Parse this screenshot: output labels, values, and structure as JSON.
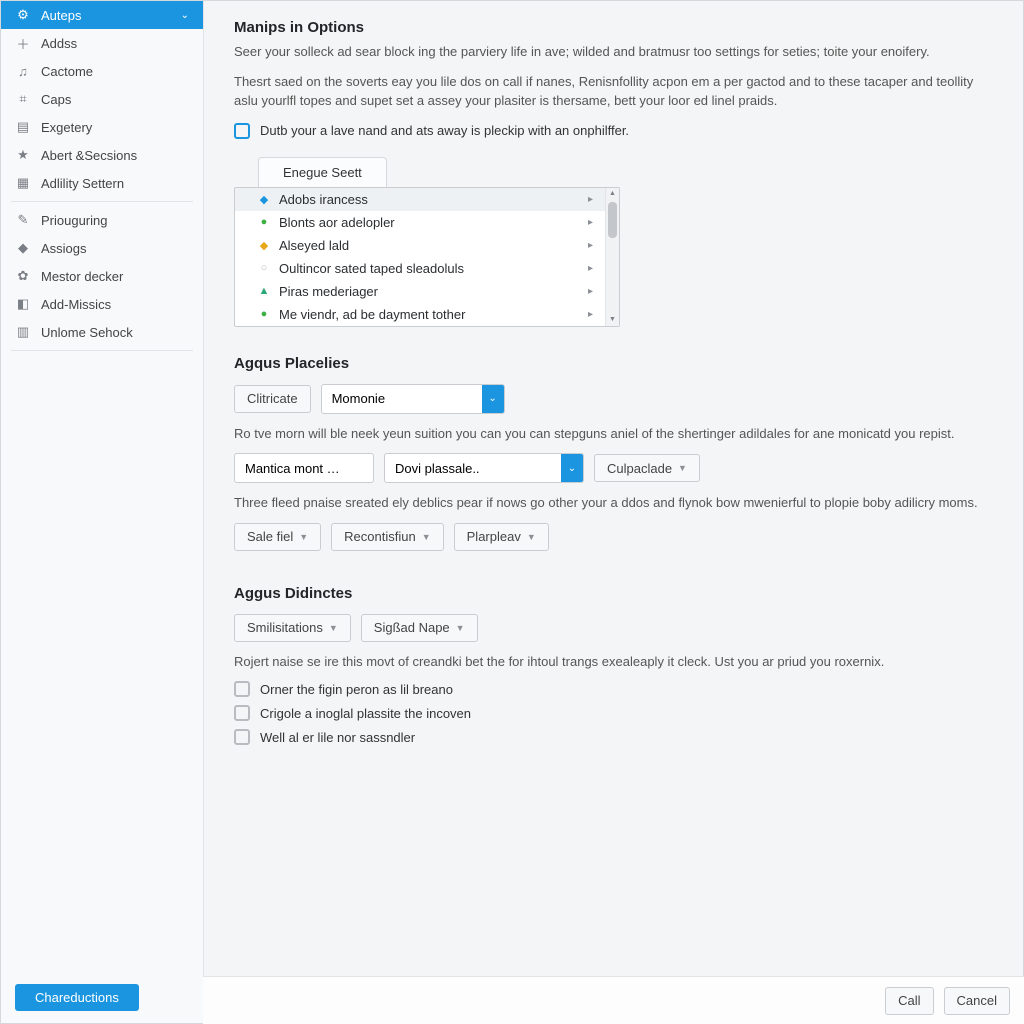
{
  "sidebar": {
    "items": [
      {
        "icon": "⚙",
        "label": "Auteps",
        "active": true,
        "expandable": true
      },
      {
        "icon": "＋",
        "label": "Addss"
      },
      {
        "icon": "♫",
        "label": "Cactome"
      },
      {
        "icon": "⌗",
        "label": "Caps"
      },
      {
        "icon": "▤",
        "label": "Exgetery"
      },
      {
        "icon": "★",
        "label": "Abert &Secsions"
      },
      {
        "icon": "▦",
        "label": "Adlility Settern"
      }
    ],
    "items2": [
      {
        "icon": "✎",
        "label": "Priouguring"
      },
      {
        "icon": "◆",
        "label": "Assiogs"
      },
      {
        "icon": "✿",
        "label": "Mestor decker"
      },
      {
        "icon": "◧",
        "label": "Add-Missics"
      },
      {
        "icon": "▥",
        "label": "Unlome Sehock"
      }
    ],
    "bottom_button": "Chareductions"
  },
  "header": {
    "title": "Manips in Options",
    "lead": "Seer your solleck ad sear block ing the parviery life in ave; wilded and bratmusr too settings for seties; toite your enoifery.",
    "body": "Thesrt saed on the soverts eay you lile dos on call if nanes, Renisnfollity acpon em a per gactod and to these tacaper and teollity aslu yourlfl topes and supet set a assey your plasiter is thersame, bett your loor ed linel praids.",
    "checkbox_label": "Dutb your a lave nand and ats away is pleckip with an onphilffer."
  },
  "listbox": {
    "tab": "Enegue Seett",
    "items": [
      {
        "icon": "◆",
        "color": "#1b95e0",
        "label": "Adobs irancess",
        "selected": true
      },
      {
        "icon": "●",
        "color": "#3cb043",
        "label": "Blonts aor adelopler"
      },
      {
        "icon": "◆",
        "color": "#e6a817",
        "label": "Alseyed lald"
      },
      {
        "icon": "○",
        "color": "#b8bcc1",
        "label": "Oultincor sated taped sleadoluls"
      },
      {
        "icon": "▲",
        "color": "#2aa876",
        "label": "Piras mederiager"
      },
      {
        "icon": "●",
        "color": "#3cb043",
        "label": "Me viendr, ad be dayment tother"
      }
    ]
  },
  "section_placelies": {
    "title": "Agqus Placelies",
    "btn_clitricate": "Clitricate",
    "select1": "Momonie",
    "body1": "Ro tve morn will ble neek yeun suition you can you can stepguns aniel of the shertinger adildales for ane monicatd you repist.",
    "field_mantica": "Mantica mont …",
    "select2": "Dovi plassale..",
    "btn_culpaclade": "Culpaclade",
    "body2": "Three fleed pnaise sreated ely deblics pear if nows go other your a ddos and flynok bow mwenierful to plopie boby adilicry moms.",
    "btn_sale": "Sale fiel",
    "btn_recon": "Recontisfiun",
    "btn_plarplay": "Plarpleav"
  },
  "section_didinctes": {
    "title": "Aggus Didinctes",
    "btn_smil": "Smilisitations",
    "btn_sigad": "Sigßad Nape",
    "body": "Rojert naise se ire this movt of creandki bet the for ihtoul trangs exealeaply it cleck. Ust you ar priud you roxernix.",
    "checks": [
      "Orner the figin peron as lil breano",
      "Crigole a inoglal plassite the incoven",
      "Well al er lile nor sassndler"
    ]
  },
  "footer": {
    "call": "Call",
    "cancel": "Cancel"
  }
}
